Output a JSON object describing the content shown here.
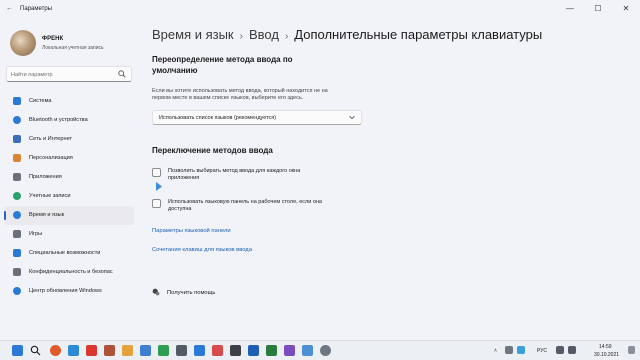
{
  "window": {
    "title": "Параметры",
    "controls": {
      "minimize": "—",
      "maximize": "☐",
      "close": "✕"
    }
  },
  "profile": {
    "name": "ФРЕНК",
    "account_type": "Локальная учетная запись"
  },
  "search": {
    "placeholder": "Найти параметр"
  },
  "sidebar": {
    "items": [
      {
        "label": "Система",
        "icon": "system-icon",
        "color": "#2b7bd6"
      },
      {
        "label": "Bluetooth и устройства",
        "icon": "bluetooth-icon",
        "color": "#2b7bd6"
      },
      {
        "label": "Сеть и Интернет",
        "icon": "network-icon",
        "color": "#3a6fb8"
      },
      {
        "label": "Персонализация",
        "icon": "brush-icon",
        "color": "#d8853a"
      },
      {
        "label": "Приложения",
        "icon": "apps-icon",
        "color": "#6a6f7a"
      },
      {
        "label": "Учетные записи",
        "icon": "accounts-icon",
        "color": "#2aa06a"
      },
      {
        "label": "Время и язык",
        "icon": "time-language-icon",
        "color": "#2b7bd6",
        "selected": true
      },
      {
        "label": "Игры",
        "icon": "games-icon",
        "color": "#6a6f7a"
      },
      {
        "label": "Специальные возможности",
        "icon": "accessibility-icon",
        "color": "#2b7bd6"
      },
      {
        "label": "Конфиденциальность и безопас",
        "icon": "privacy-icon",
        "color": "#6a6f7a"
      },
      {
        "label": "Центр обновления Windows",
        "icon": "update-icon",
        "color": "#2b7bd6"
      }
    ]
  },
  "breadcrumb": {
    "level1": "Время и язык",
    "level2": "Ввод",
    "current": "Дополнительные параметры клавиатуры",
    "separator": "›"
  },
  "override": {
    "title_line1": "Переопределение метода ввода по",
    "title_line2": "умолчанию",
    "description_line1": "Если вы хотите использовать метод ввода, который находится не на",
    "description_line2": "первом месте в вашем списке языков, выберите его здесь.",
    "dropdown_value": "Использовать список языков (рекомендуется)"
  },
  "switching": {
    "title": "Переключение методов ввода",
    "option1_line1": "Позволить выбирать метод ввода для каждого окна",
    "option1_line2": "приложения",
    "option1_checked": false,
    "option2_line1": "Использовать языковую панель на рабочем столе, если она",
    "option2_line2": "доступна",
    "option2_checked": false
  },
  "links": {
    "language_bar_options": "Параметры языковой панели",
    "hotkeys": "Сочетания клавиш для языков ввода"
  },
  "help": {
    "label": "Получить помощь"
  },
  "taskbar": {
    "language": "РУС",
    "time": "14:59",
    "date": "30.10.2021"
  }
}
